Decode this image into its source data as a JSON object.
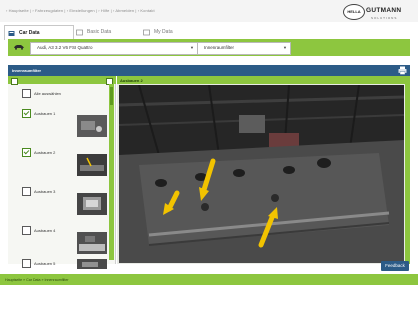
{
  "top_nav": {
    "breadcrumbs": "› Hauptseite | › Fahrzeugdaten | › Einstellungen | › Hilfe | › Abmelden | › Kontakt"
  },
  "logo": {
    "mark": "HELLA",
    "name": "GUTMANN",
    "sub": "SOLUTIONS"
  },
  "tabs": [
    {
      "label": "Car Data",
      "active": true
    },
    {
      "label": "Basic Data",
      "active": false
    },
    {
      "label": "My Data",
      "active": false
    }
  ],
  "toolbar": {
    "vehicle_select": "Audi, A3 3.2 V6 FSI Quattro",
    "component_select": "Innenraumfilter"
  },
  "title_bar": {
    "title": "Innenraumfilter",
    "print_icon": "printer-icon"
  },
  "left_panel": {
    "items": [
      {
        "label": "Alle auswählen",
        "checked": false,
        "has_thumb": false
      },
      {
        "label": "Ausbauen 1",
        "checked": true,
        "has_thumb": true
      },
      {
        "label": "Ausbauen 2",
        "checked": true,
        "has_thumb": true
      },
      {
        "label": "Ausbauen 3",
        "checked": false,
        "has_thumb": true
      },
      {
        "label": "Ausbauen 4",
        "checked": false,
        "has_thumb": true
      },
      {
        "label": "Ausbauen 5",
        "checked": false,
        "has_thumb": true
      }
    ]
  },
  "main_panel": {
    "title": "Ausbauen 2",
    "photo_description": "Fahrzeug-Unterseite mit markierten Schrauben"
  },
  "footer": {
    "feedback_label": "Feedback",
    "status_breadcrumb": "Hauptseite » Car Data » Innenraumfilter"
  },
  "colors": {
    "accent_green": "#8dc63f",
    "title_blue": "#2c5b87",
    "arrow_yellow": "#f2c300"
  }
}
